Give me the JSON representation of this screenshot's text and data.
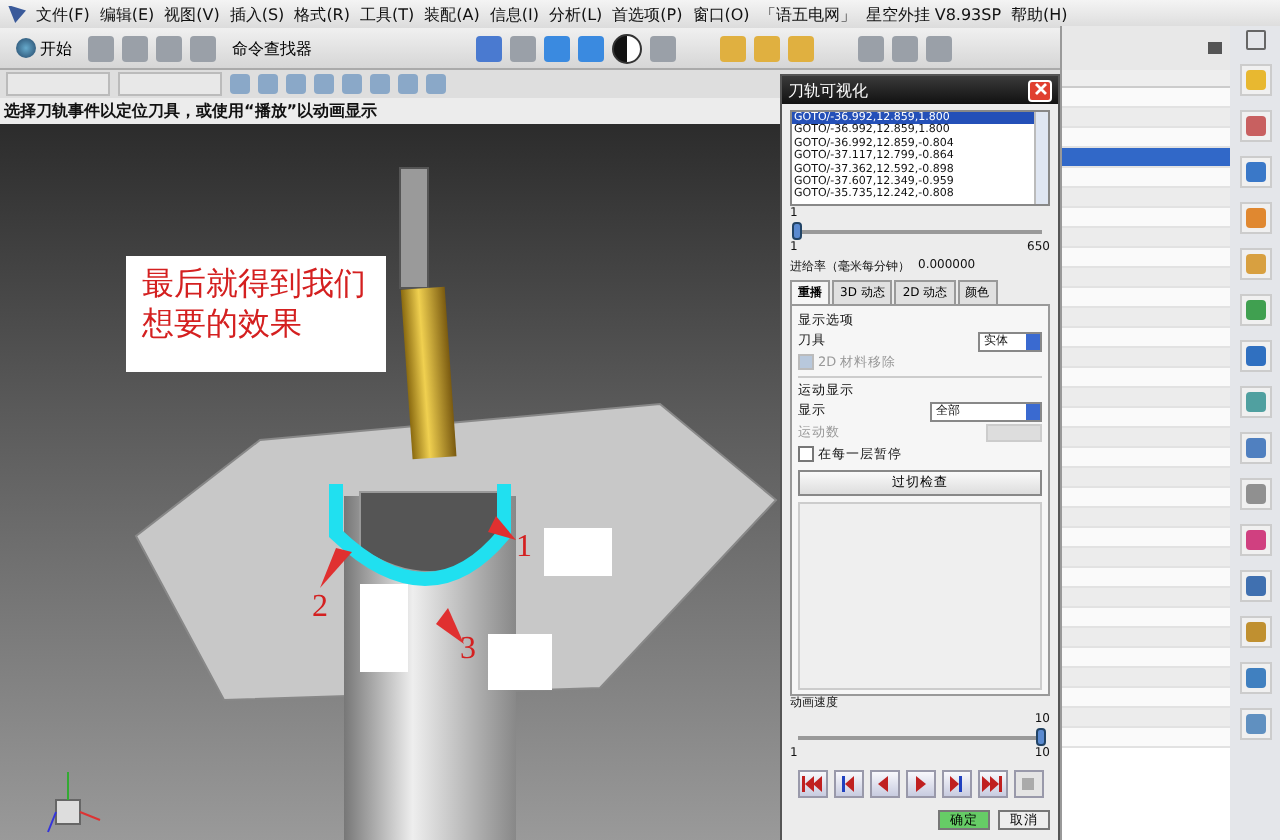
{
  "menu_bar": [
    "文件(F)",
    "编辑(E)",
    "视图(V)",
    "插入(S)",
    "格式(R)",
    "工具(T)",
    "装配(A)",
    "信息(I)",
    "分析(L)",
    "首选项(P)",
    "窗口(O)",
    "「语五电网」",
    "星空外挂 V8.93SP",
    "帮助(H)"
  ],
  "toolbar": {
    "start": "开始",
    "command_finder": "命令查找器"
  },
  "status_text": "选择刀轨事件以定位刀具，或使用“播放”以动画显示",
  "canvas": {
    "callout": "最后就得到我们想要的效果",
    "markers": [
      "1",
      "2",
      "3"
    ]
  },
  "dialog": {
    "title": "刀轨可视化",
    "events": [
      {
        "text": "GOTO/-36.992,12.859,1.800",
        "selected": true
      },
      {
        "text": "GOTO/-36.992,12.859,1.800",
        "selected": false
      },
      {
        "text": "GOTO/-36.992,12.859,-0.804",
        "selected": false
      },
      {
        "text": "GOTO/-37.117,12.799,-0.864",
        "selected": false
      },
      {
        "text": "GOTO/-37.362,12.592,-0.898",
        "selected": false
      },
      {
        "text": "GOTO/-37.607,12.349,-0.959",
        "selected": false
      },
      {
        "text": "GOTO/-35.735,12.242,-0.808",
        "selected": false
      }
    ],
    "position": {
      "value": "1",
      "min": "1",
      "max": "650",
      "level": 0
    },
    "feed_rate": {
      "label": "进给率（毫米每分钟）",
      "value": "0.000000"
    },
    "tabs": [
      {
        "label": "重播",
        "selected": true
      },
      {
        "label": "3D 动态",
        "selected": false
      },
      {
        "label": "2D 动态",
        "selected": false
      },
      {
        "label": "颜色",
        "selected": false
      }
    ],
    "display_options": {
      "heading": "显示选项",
      "tool_label": "刀具",
      "tool_value": "实体",
      "check": {
        "label": "2D 材料移除",
        "checked": true,
        "disabled": true
      }
    },
    "motion_display": {
      "heading": "运动显示",
      "display_label": "显示",
      "display_value": "全部",
      "count_label": "运动数",
      "count_disabled": true,
      "check": {
        "label": "在每一层暂停",
        "checked": false,
        "disabled": false
      }
    },
    "check_button": "过切检查",
    "speed": {
      "label": "动画速度",
      "value": "10",
      "min": "1",
      "max": "10",
      "level": 1
    },
    "ok": "确定",
    "cancel": "取消"
  },
  "navigator": {
    "rows": [
      {
        "selected": false
      },
      {
        "selected": false
      },
      {
        "selected": false
      },
      {
        "selected": true
      },
      {
        "selected": false
      },
      {
        "selected": false
      },
      {
        "selected": false
      },
      {
        "selected": false
      },
      {
        "selected": false
      },
      {
        "selected": false
      },
      {
        "selected": false
      },
      {
        "selected": false
      },
      {
        "selected": false
      },
      {
        "selected": false
      },
      {
        "selected": false
      },
      {
        "selected": false
      },
      {
        "selected": false
      },
      {
        "selected": false
      },
      {
        "selected": false
      },
      {
        "selected": false
      },
      {
        "selected": false
      },
      {
        "selected": false
      },
      {
        "selected": false
      },
      {
        "selected": false
      },
      {
        "selected": false
      },
      {
        "selected": false
      },
      {
        "selected": false
      },
      {
        "selected": false
      },
      {
        "selected": false
      },
      {
        "selected": false
      },
      {
        "selected": false
      },
      {
        "selected": false
      },
      {
        "selected": false
      }
    ]
  }
}
